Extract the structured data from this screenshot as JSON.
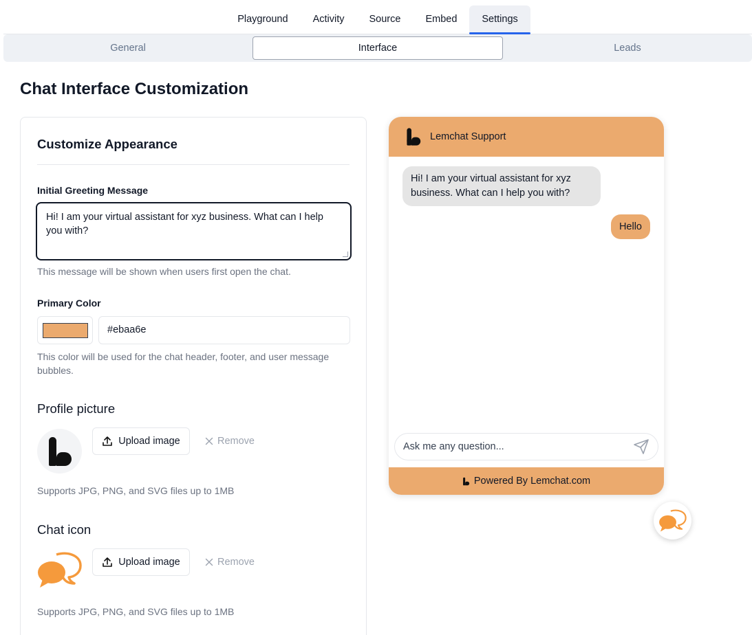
{
  "top_tabs": [
    {
      "label": "Playground"
    },
    {
      "label": "Activity"
    },
    {
      "label": "Source"
    },
    {
      "label": "Embed"
    },
    {
      "label": "Settings",
      "active": true
    }
  ],
  "sub_tabs": [
    {
      "label": "General"
    },
    {
      "label": "Interface",
      "active": true
    },
    {
      "label": "Leads"
    }
  ],
  "page_title": "Chat Interface Customization",
  "panel": {
    "heading": "Customize Appearance",
    "greeting": {
      "label": "Initial Greeting Message",
      "value": "Hi! I am your virtual assistant for xyz business. What can I help you with?",
      "help": "This message will be shown when users first open the chat."
    },
    "primary_color": {
      "label": "Primary Color",
      "value": "#ebaa6e",
      "help": "This color will be used for the chat header, footer, and user message bubbles."
    },
    "profile_picture": {
      "heading": "Profile picture",
      "upload_label": "Upload image",
      "remove_label": "Remove",
      "help": "Supports JPG, PNG, and SVG files up to 1MB"
    },
    "chat_icon": {
      "heading": "Chat icon",
      "upload_label": "Upload image",
      "remove_label": "Remove",
      "help": "Supports JPG, PNG, and SVG files up to 1MB"
    }
  },
  "chat_preview": {
    "header_title": "Lemchat Support",
    "bot_message": "Hi! I am your virtual assistant for xyz business. What can I help you with?",
    "user_message": "Hello",
    "input_placeholder": "Ask me any question...",
    "footer_text": "Powered By Lemchat.com"
  },
  "colors": {
    "primary": "#ebaa6e",
    "icon_orange": "#f59a3c",
    "tab_accent": "#2563eb"
  },
  "icons": [
    "upload-icon",
    "close-icon",
    "send-icon",
    "lemchat-logo-icon",
    "chat-bubbles-icon"
  ]
}
